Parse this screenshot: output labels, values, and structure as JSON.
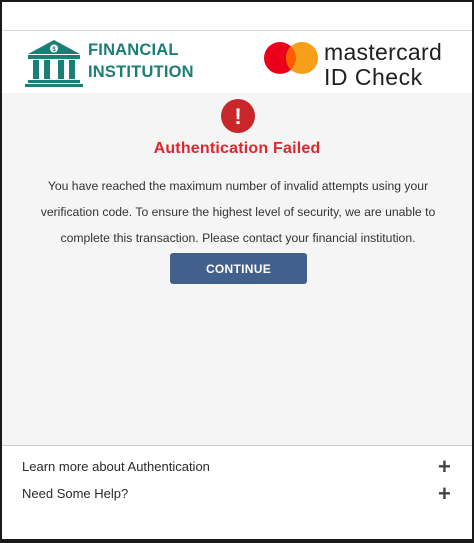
{
  "header": {
    "bank_name_line1": "FINANCIAL",
    "bank_name_line2": "INSTITUTION",
    "mc_word": "mastercard",
    "mc_product": "ID Check"
  },
  "main": {
    "alert_glyph": "!",
    "title": "Authentication Failed",
    "message_lines": [
      "You have reached the maximum number of invalid attempts using your",
      "verification code. To ensure the highest level of security, we are unable to",
      "complete this transaction. Please contact your financial institution."
    ],
    "continue_label": "CONTINUE"
  },
  "footer": {
    "items": [
      {
        "label": "Learn more about Authentication",
        "icon": "plus-icon"
      },
      {
        "label": "Need Some Help?",
        "icon": "plus-icon"
      }
    ],
    "expand_glyph": "+"
  },
  "colors": {
    "bank_green": "#1b7f75",
    "error_red": "#e0252d",
    "alert_circle": "#c8262b",
    "button_blue": "#41618c",
    "mc_red": "#eb001b",
    "mc_orange": "#f79e1b",
    "mc_overlap": "#ff5f00"
  }
}
